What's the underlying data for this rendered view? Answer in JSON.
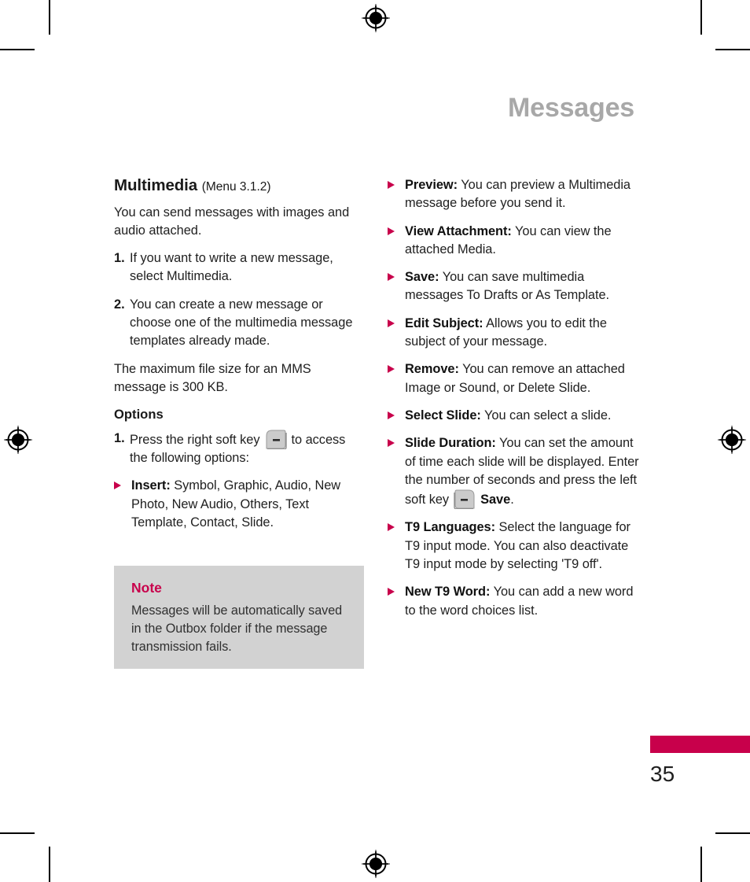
{
  "running_head": "Messages",
  "colors": {
    "accent": "#c8004b",
    "running_head_grey": "#a8a8a8",
    "note_bg": "#d2d2d2"
  },
  "left_column": {
    "section_title": "Multimedia",
    "section_menu_ref": "(Menu 3.1.2)",
    "intro": "You can send messages with images and audio attached.",
    "steps": [
      {
        "num": "1.",
        "text": "If you want to write a new message, select Multimedia."
      },
      {
        "num": "2.",
        "text": "You can create a new message or choose one of the multimedia message templates already made."
      }
    ],
    "max_size_note": "The maximum file size for an MMS message is 300 KB.",
    "options_title": "Options",
    "options_step": {
      "num": "1.",
      "text_before": "Press the right soft key",
      "icon": "right-soft-key-icon",
      "text_after": "to access the following options:"
    },
    "insert_bullet": {
      "term": "Insert:",
      "desc": "Symbol, Graphic, Audio, New Photo, New Audio, Others, Text Template, Contact, Slide."
    },
    "note": {
      "title": "Note",
      "text": "Messages will be automatically saved in the Outbox folder if the message transmission fails."
    }
  },
  "right_column": {
    "bullets": [
      {
        "term": "Preview:",
        "desc": "You can preview a Multimedia message before you send it."
      },
      {
        "term": "View Attachment:",
        "desc": "You can view the attached Media."
      },
      {
        "term": "Save:",
        "desc": "You can save multimedia messages To Drafts or As Template."
      },
      {
        "term": "Edit Subject:",
        "desc": "Allows you to edit the subject of your message."
      },
      {
        "term": "Remove:",
        "desc": "You can remove an attached Image or Sound, or Delete Slide."
      },
      {
        "term": "Select Slide:",
        "desc": "You can select a slide."
      },
      {
        "term": "T9 Languages:",
        "desc": "Select the language for T9 input mode. You can also deactivate T9 input mode by selecting 'T9 off'."
      },
      {
        "term": "New T9 Word:",
        "desc": "You can add a new word to the word choices list."
      }
    ],
    "slide_duration": {
      "term": "Slide Duration:",
      "desc_before": "You can set the amount of time each slide will be displayed. Enter the number of seconds and press the left soft key",
      "icon": "left-soft-key-icon",
      "save_label": "Save",
      "desc_after": "."
    }
  },
  "folio": {
    "page_number": "35"
  }
}
